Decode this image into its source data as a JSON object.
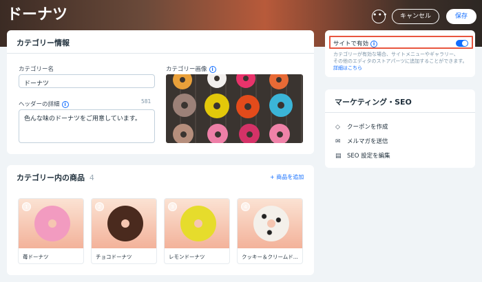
{
  "header": {
    "title": "ドーナツ",
    "more_label": "•••",
    "cancel_label": "キャンセル",
    "save_label": "保存"
  },
  "category_info": {
    "title": "カテゴリー情報",
    "name_label": "カテゴリー名",
    "name_value": "ドーナツ",
    "image_label": "カテゴリー画像",
    "header_details_label": "ヘッダーの詳細",
    "char_count": "581",
    "header_details_value": "色んな味のドーナツをご用意しています。"
  },
  "products": {
    "title": "カテゴリー内の商品",
    "count": "4",
    "add_label": "+ 商品を追加",
    "items": [
      {
        "num": "1",
        "name": "苺ドーナツ",
        "color": "#f29bc0"
      },
      {
        "num": "2",
        "name": "チョコドーナツ",
        "color": "#4a2a1e"
      },
      {
        "num": "3",
        "name": "レモンドーナツ",
        "color": "#e6dc2c"
      },
      {
        "num": "4",
        "name": "クッキー＆クリームド...",
        "color": "#f4f0ea"
      }
    ]
  },
  "visibility": {
    "label": "サイトで有効",
    "enabled": true,
    "description_line1": "カテゴリーが有効な場合、サイトメニューやギャラリー、",
    "description_line2": "その他のエディタのストアパーツに追加することができます。",
    "more_link": "詳細はこちら"
  },
  "marketing": {
    "title": "マーケティング・SEO",
    "items": [
      {
        "label": "クーポンを作成",
        "icon": "coupon-icon"
      },
      {
        "label": "メルマガを送信",
        "icon": "mail-icon"
      },
      {
        "label": "SEO 設定を編集",
        "icon": "seo-icon"
      }
    ]
  },
  "colors": {
    "accent": "#116dff",
    "highlight": "#e8553e",
    "background": "#f0f4f7"
  }
}
